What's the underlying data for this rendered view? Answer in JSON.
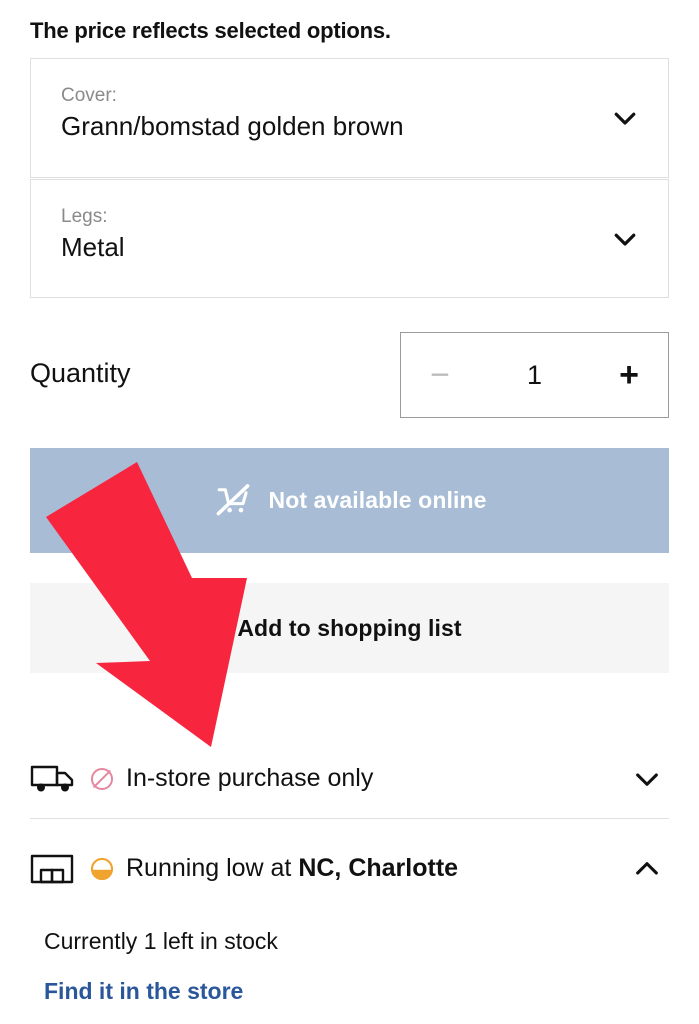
{
  "page": {
    "price_note": "The price reflects selected options."
  },
  "options": [
    {
      "id": "cover",
      "label": "Cover:",
      "value": "Grann/bomstad golden brown",
      "chevron_icon": "chevron-down-icon"
    },
    {
      "id": "legs",
      "label": "Legs:",
      "value": "Metal",
      "chevron_icon": "chevron-down-icon"
    }
  ],
  "quantity": {
    "label": "Quantity",
    "decrement_label": "−",
    "value": "1",
    "increment_label": "+",
    "decrement_disabled": true
  },
  "primary_button": {
    "label": "Not available online",
    "icon": "cart-slashed-icon",
    "background_color": "#a8bdd5",
    "text_color": "#ffffff",
    "disabled": true
  },
  "secondary_button": {
    "label": "Add to shopping list",
    "background_color": "#f5f5f5",
    "text_color": "#111111"
  },
  "availability": [
    {
      "id": "delivery",
      "main_icon": "delivery-truck-icon",
      "status_icon": "no-entry-circle-icon",
      "status_color": "#e4879f",
      "text_plain": "In-store purchase only",
      "text_bold": "",
      "chevron_icon": "chevron-down-icon",
      "expanded": false
    },
    {
      "id": "store",
      "main_icon": "store-front-icon",
      "status_icon": "half-full-circle-icon",
      "status_color": "#f0a32e",
      "text_plain": "Running low at ",
      "text_bold": "NC, Charlotte",
      "chevron_icon": "chevron-up-icon",
      "expanded": true
    }
  ],
  "store_detail": {
    "stock_text": "Currently 1 left in stock",
    "find_link_label": "Find it in the store",
    "link_color": "#2a5799"
  },
  "annotation": {
    "type": "arrow",
    "color": "#f8253f",
    "points_to": "Add to shopping list"
  }
}
